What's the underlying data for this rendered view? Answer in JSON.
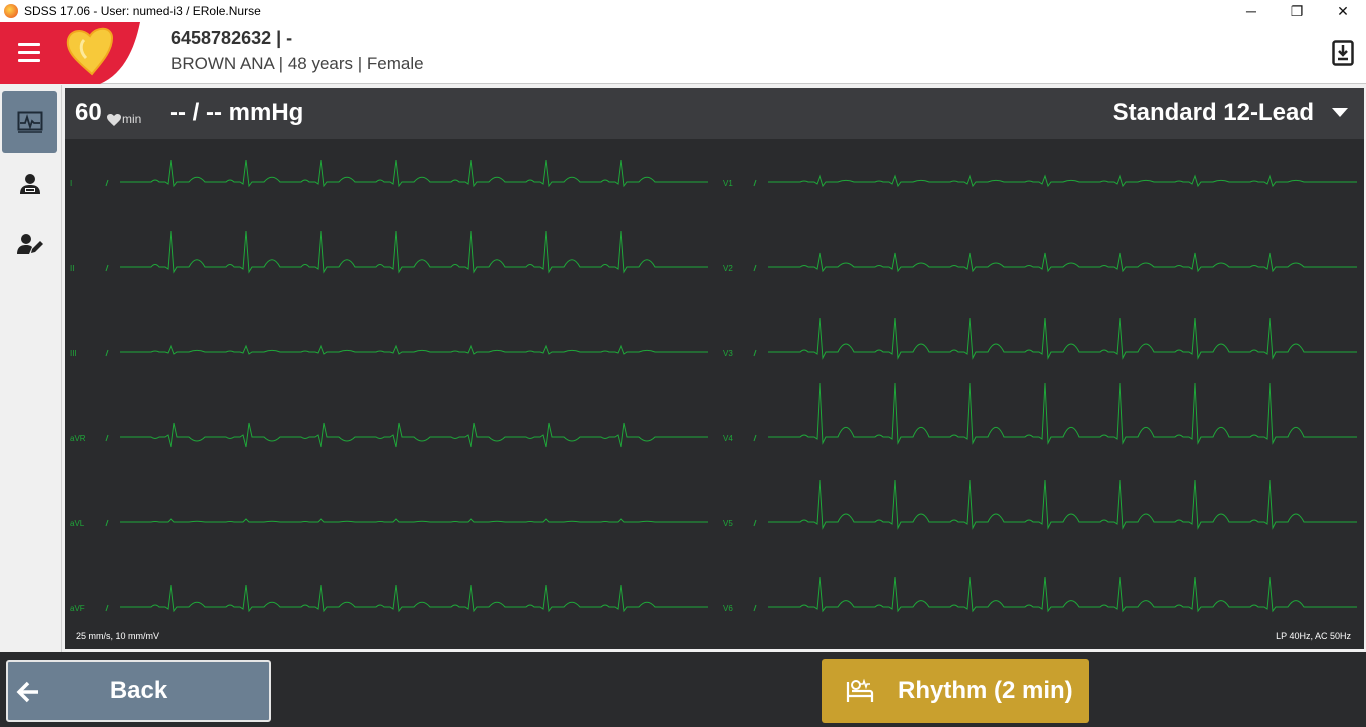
{
  "window": {
    "title": "SDSS 17.06 - User: numed-i3 / ERole.Nurse",
    "controls": {
      "minimize": "─",
      "restore": "❐",
      "close": "✕"
    }
  },
  "header": {
    "patient_id": "6458782632 | -",
    "patient_info": "BROWN ANA | 48 years | Female"
  },
  "vitals": {
    "heart_rate": "60",
    "heart_rate_unit": "min",
    "blood_pressure": "-- / -- mmHg",
    "lead_mode": "Standard 12-Lead"
  },
  "ecg": {
    "leads_left": [
      "I",
      "II",
      "III",
      "aVR",
      "aVL",
      "aVF"
    ],
    "leads_right": [
      "V1",
      "V2",
      "V3",
      "V4",
      "V5",
      "V6"
    ],
    "settings_left": "25 mm/s, 10 mm/mV",
    "settings_right": "LP 40Hz, AC 50Hz",
    "trace_color": "#1fa83a"
  },
  "buttons": {
    "back": "Back",
    "rhythm": "Rhythm (2 min)"
  },
  "colors": {
    "brand_red": "#e3213b",
    "accent_slate": "#6b7f92",
    "accent_gold": "#c9a02e"
  }
}
